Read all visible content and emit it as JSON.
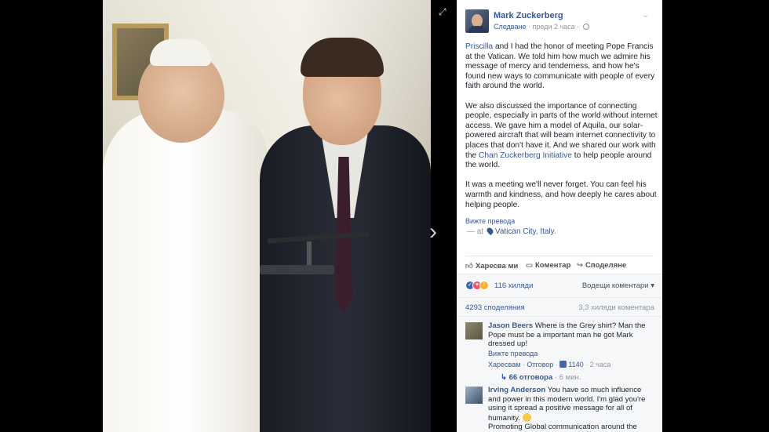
{
  "post": {
    "author": "Mark Zuckerberg",
    "follow_label": "Следване",
    "timestamp": "преди 2 часа",
    "paragraph1_link": "Priscilla",
    "paragraph1_text": " and I had the honor of meeting Pope Francis at the Vatican. We told him how much we admire his message of mercy and tenderness, and how he's found new ways to communicate with people of every faith around the world.",
    "paragraph2_text": "We also discussed the importance of connecting people, especially in parts of the world without internet access. We gave him a model of Aquila, our solar-powered aircraft that will beam internet connectivity to places that don't have it. And we shared our work with the ",
    "paragraph2_link": "Chan Zuckerberg Initiative",
    "paragraph2_end": " to help people around the world.",
    "paragraph3_text": "It was a meeting we'll never forget. You can feel his warmth and kindness, and how deeply he cares about helping people.",
    "see_translation": "Вижте превода",
    "location_prefix": "— at ",
    "location": "Vatican City, Italy."
  },
  "actions": {
    "like": "Харесва ми",
    "comment": "Коментар",
    "share": "Споделяне"
  },
  "summary": {
    "reaction_count": "116 хиляди",
    "top_comments": "Водещи коментари",
    "shares": "4293 споделяния",
    "comments_count": "3,3 хиляди коментара"
  },
  "comments": [
    {
      "name": "Jason Beers",
      "text": " Where is the Grey shirt? Man the Pope must be a important man he got Mark dressed up!",
      "see_translation": "Вижте превода",
      "like_label": "Харесвам",
      "reply_label": "Отговор",
      "likes": "1140",
      "time": "2 часа",
      "replies": "66 отговора",
      "replies_time": "6 мин."
    },
    {
      "name": "Irving Anderson",
      "text": " You have so much influence and power in this modern world. I'm glad you're using it spread a positive message for all of humanity. ",
      "text2": "Promoting Global communication around the world, we have the opportunity to learn & listen from each"
    }
  ],
  "icons": {
    "expand": "expand-icon",
    "next": "chevron-right-icon",
    "globe": "globe-icon",
    "chevron": "chevron-down-icon"
  },
  "colors": {
    "link": "#365899",
    "like_reaction": "#4267b2",
    "love_reaction": "#f25268",
    "wow_reaction": "#f7b125"
  }
}
